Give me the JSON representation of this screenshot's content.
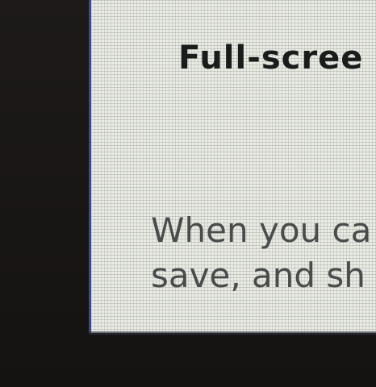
{
  "dialog": {
    "title": "Full-scree",
    "body_lines": [
      "When you ca",
      "save, and sh"
    ]
  },
  "colors": {
    "screen_background": "#e9ebe4",
    "bezel": "#1b1817",
    "title_text": "#1a1c1c",
    "body_text": "#4a4c4c",
    "screen_edge_accent": "#3a4a8a"
  }
}
